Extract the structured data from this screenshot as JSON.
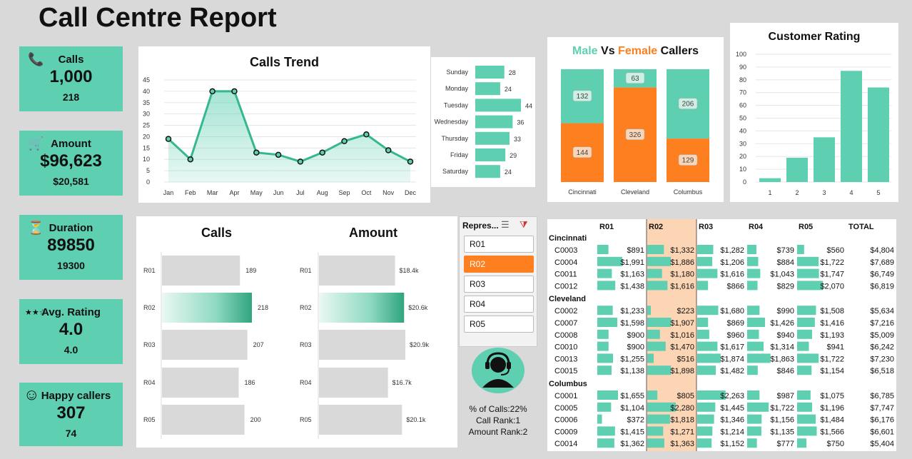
{
  "title": "Call Centre Report",
  "colors": {
    "accent": "#5ecfb1",
    "orange": "#fd7f1f",
    "teal_dark": "#2fa57f"
  },
  "kpis": [
    {
      "icon": "phone-icon",
      "glyph": "📞",
      "label": "Calls",
      "value": "1,000",
      "sub": "218"
    },
    {
      "icon": "cart-icon",
      "glyph": "🛒",
      "label": "Amount",
      "value": "$96,623",
      "sub": "$20,581"
    },
    {
      "icon": "hourglass-icon",
      "glyph": "⏳",
      "label": "Duration",
      "value": "89850",
      "sub": "19300"
    },
    {
      "icon": "stars-icon",
      "glyph": "★★☆",
      "label": "Avg. Rating",
      "value": "4.0",
      "sub": "4.0"
    },
    {
      "icon": "smiley-icon",
      "glyph": "☺",
      "label": "Happy callers",
      "value": "307",
      "sub": "74"
    }
  ],
  "calls_trend": {
    "title": "Calls Trend",
    "months": [
      "Jan",
      "Feb",
      "Mar",
      "Apr",
      "May",
      "Jun",
      "Jul",
      "Aug",
      "Sep",
      "Oct",
      "Nov",
      "Dec"
    ],
    "values": [
      19,
      10,
      40,
      40,
      13,
      12,
      9,
      13,
      18,
      21,
      14,
      9
    ],
    "yticks": [
      0,
      5,
      10,
      15,
      20,
      25,
      30,
      35,
      40,
      45
    ]
  },
  "weekday": {
    "days": [
      "Sunday",
      "Monday",
      "Tuesday",
      "Wednesday",
      "Thursday",
      "Friday",
      "Saturday"
    ],
    "values": [
      28,
      24,
      44,
      36,
      33,
      29,
      24
    ]
  },
  "gender": {
    "title_male": "Male",
    "title_vs": "Vs",
    "title_female": "Female",
    "title_callers": "Callers",
    "cities": [
      "Cincinnati",
      "Cleveland",
      "Columbus"
    ],
    "male": [
      132,
      63,
      206
    ],
    "female": [
      144,
      326,
      129
    ]
  },
  "rating": {
    "title": "Customer Rating",
    "categories": [
      "1",
      "2",
      "3",
      "4",
      "5"
    ],
    "values": [
      3,
      19,
      35,
      87,
      74
    ],
    "yticks": [
      0,
      10,
      20,
      30,
      40,
      50,
      60,
      70,
      80,
      90,
      100
    ]
  },
  "rep_calls": {
    "title": "Calls",
    "reps": [
      "R01",
      "R02",
      "R03",
      "R04",
      "R05"
    ],
    "values": [
      189,
      218,
      207,
      186,
      200
    ],
    "labels": [
      "189",
      "218",
      "207",
      "186",
      "200"
    ]
  },
  "rep_amount": {
    "title": "Amount",
    "reps": [
      "R01",
      "R02",
      "R03",
      "R04",
      "R05"
    ],
    "values": [
      18.4,
      20.6,
      20.9,
      16.7,
      20.1
    ],
    "labels": [
      "$18.4k",
      "$20.6k",
      "$20.9k",
      "$16.7k",
      "$20.1k"
    ]
  },
  "slicer": {
    "title": "Repres...",
    "options": [
      "R01",
      "R02",
      "R03",
      "R04",
      "R05"
    ],
    "selected": "R02"
  },
  "rep_card": {
    "pct_calls": "% of Calls:22%",
    "call_rank": "Call Rank:1",
    "amount_rank": "Amount Rank:2"
  },
  "matrix": {
    "headers": [
      "R01",
      "R02",
      "R03",
      "R04",
      "R05",
      "TOTAL"
    ],
    "groups": [
      {
        "city": "Cincinnati",
        "rows": [
          {
            "id": "C0003",
            "vals": [
              891,
              1332,
              1282,
              739,
              560
            ],
            "labels": [
              "$891",
              "$1,332",
              "$1,282",
              "$739",
              "$560"
            ],
            "total": "$4,804"
          },
          {
            "id": "C0004",
            "vals": [
              1991,
              1886,
              1206,
              884,
              1722
            ],
            "labels": [
              "$1,991",
              "$1,886",
              "$1,206",
              "$884",
              "$1,722"
            ],
            "total": "$7,689"
          },
          {
            "id": "C0011",
            "vals": [
              1163,
              1180,
              1616,
              1043,
              1747
            ],
            "labels": [
              "$1,163",
              "$1,180",
              "$1,616",
              "$1,043",
              "$1,747"
            ],
            "total": "$6,749"
          },
          {
            "id": "C0012",
            "vals": [
              1438,
              1616,
              866,
              829,
              2070
            ],
            "labels": [
              "$1,438",
              "$1,616",
              "$866",
              "$829",
              "$2,070"
            ],
            "total": "$6,819"
          }
        ]
      },
      {
        "city": "Cleveland",
        "rows": [
          {
            "id": "C0002",
            "vals": [
              1233,
              223,
              1680,
              990,
              1508
            ],
            "labels": [
              "$1,233",
              "$223",
              "$1,680",
              "$990",
              "$1,508"
            ],
            "total": "$5,634"
          },
          {
            "id": "C0007",
            "vals": [
              1598,
              1907,
              869,
              1426,
              1416
            ],
            "labels": [
              "$1,598",
              "$1,907",
              "$869",
              "$1,426",
              "$1,416"
            ],
            "total": "$7,216"
          },
          {
            "id": "C0008",
            "vals": [
              900,
              1016,
              960,
              940,
              1193
            ],
            "labels": [
              "$900",
              "$1,016",
              "$960",
              "$940",
              "$1,193"
            ],
            "total": "$5,009"
          },
          {
            "id": "C0010",
            "vals": [
              900,
              1470,
              1617,
              1314,
              941
            ],
            "labels": [
              "$900",
              "$1,470",
              "$1,617",
              "$1,314",
              "$941"
            ],
            "total": "$6,242"
          },
          {
            "id": "C0013",
            "vals": [
              1255,
              516,
              1874,
              1863,
              1722
            ],
            "labels": [
              "$1,255",
              "$516",
              "$1,874",
              "$1,863",
              "$1,722"
            ],
            "total": "$7,230"
          },
          {
            "id": "C0015",
            "vals": [
              1138,
              1898,
              1482,
              846,
              1154
            ],
            "labels": [
              "$1,138",
              "$1,898",
              "$1,482",
              "$846",
              "$1,154"
            ],
            "total": "$6,518"
          }
        ]
      },
      {
        "city": "Columbus",
        "rows": [
          {
            "id": "C0001",
            "vals": [
              1655,
              805,
              2263,
              987,
              1075
            ],
            "labels": [
              "$1,655",
              "$805",
              "$2,263",
              "$987",
              "$1,075"
            ],
            "total": "$6,785"
          },
          {
            "id": "C0005",
            "vals": [
              1104,
              2280,
              1445,
              1722,
              1196
            ],
            "labels": [
              "$1,104",
              "$2,280",
              "$1,445",
              "$1,722",
              "$1,196"
            ],
            "total": "$7,747"
          },
          {
            "id": "C0006",
            "vals": [
              372,
              1818,
              1346,
              1156,
              1484
            ],
            "labels": [
              "$372",
              "$1,818",
              "$1,346",
              "$1,156",
              "$1,484"
            ],
            "total": "$6,176"
          },
          {
            "id": "C0009",
            "vals": [
              1415,
              1271,
              1214,
              1135,
              1566
            ],
            "labels": [
              "$1,415",
              "$1,271",
              "$1,214",
              "$1,135",
              "$1,566"
            ],
            "total": "$6,601"
          },
          {
            "id": "C0014",
            "vals": [
              1362,
              1363,
              1152,
              777,
              750
            ],
            "labels": [
              "$1,362",
              "$1,363",
              "$1,152",
              "$777",
              "$750"
            ],
            "total": "$5,404"
          }
        ]
      }
    ]
  },
  "chart_data": [
    {
      "type": "area",
      "title": "Calls Trend",
      "categories": [
        "Jan",
        "Feb",
        "Mar",
        "Apr",
        "May",
        "Jun",
        "Jul",
        "Aug",
        "Sep",
        "Oct",
        "Nov",
        "Dec"
      ],
      "values": [
        19,
        10,
        40,
        40,
        13,
        12,
        9,
        13,
        18,
        21,
        14,
        9
      ],
      "ylim": [
        0,
        45
      ]
    },
    {
      "type": "bar",
      "categories": [
        "Sunday",
        "Monday",
        "Tuesday",
        "Wednesday",
        "Thursday",
        "Friday",
        "Saturday"
      ],
      "values": [
        28,
        24,
        44,
        36,
        33,
        29,
        24
      ]
    },
    {
      "type": "bar",
      "title": "Male Vs Female Callers",
      "categories": [
        "Cincinnati",
        "Cleveland",
        "Columbus"
      ],
      "series": [
        {
          "name": "Male",
          "values": [
            132,
            63,
            206
          ]
        },
        {
          "name": "Female",
          "values": [
            144,
            326,
            129
          ]
        }
      ]
    },
    {
      "type": "bar",
      "title": "Customer Rating",
      "categories": [
        "1",
        "2",
        "3",
        "4",
        "5"
      ],
      "values": [
        3,
        19,
        35,
        87,
        74
      ],
      "ylim": [
        0,
        100
      ]
    },
    {
      "type": "bar",
      "title": "Calls",
      "categories": [
        "R01",
        "R02",
        "R03",
        "R04",
        "R05"
      ],
      "values": [
        189,
        218,
        207,
        186,
        200
      ]
    },
    {
      "type": "bar",
      "title": "Amount",
      "categories": [
        "R01",
        "R02",
        "R03",
        "R04",
        "R05"
      ],
      "values": [
        18.4,
        20.6,
        20.9,
        16.7,
        20.1
      ]
    }
  ]
}
